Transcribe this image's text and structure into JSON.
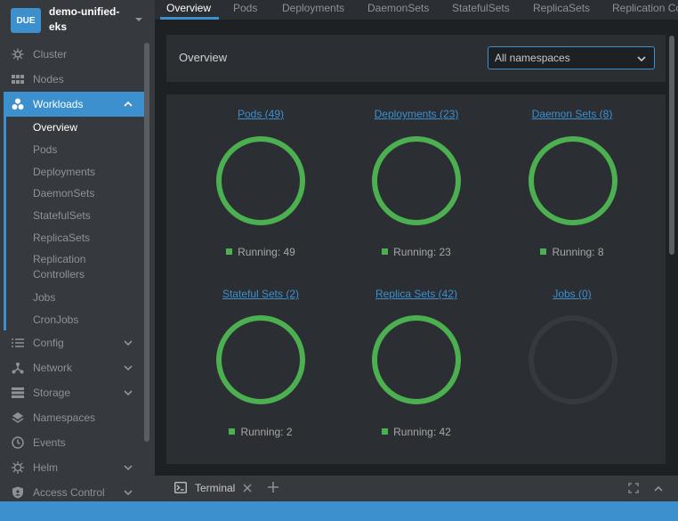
{
  "cluster": {
    "badge": "DUE",
    "name": "demo-unified-eks"
  },
  "sidebar": {
    "items": [
      {
        "label": "Cluster",
        "icon": "cluster-icon"
      },
      {
        "label": "Nodes",
        "icon": "nodes-icon"
      },
      {
        "label": "Workloads",
        "icon": "workloads-icon",
        "expanded": true
      },
      {
        "label": "Config",
        "icon": "config-icon"
      },
      {
        "label": "Network",
        "icon": "network-icon"
      },
      {
        "label": "Storage",
        "icon": "storage-icon"
      },
      {
        "label": "Namespaces",
        "icon": "namespaces-icon"
      },
      {
        "label": "Events",
        "icon": "events-icon"
      },
      {
        "label": "Helm",
        "icon": "helm-icon"
      },
      {
        "label": "Access Control",
        "icon": "access-control-icon"
      }
    ],
    "workloads_sub": [
      "Overview",
      "Pods",
      "Deployments",
      "DaemonSets",
      "StatefulSets",
      "ReplicaSets",
      "Replication Controllers",
      "Jobs",
      "CronJobs"
    ]
  },
  "tabs": [
    "Overview",
    "Pods",
    "Deployments",
    "DaemonSets",
    "StatefulSets",
    "ReplicaSets",
    "Replication Controllers"
  ],
  "overview": {
    "title": "Overview",
    "namespace_select": "All namespaces"
  },
  "charts": [
    {
      "title": "Pods (49)",
      "legend": "Running: 49",
      "running": 49,
      "total": 49
    },
    {
      "title": "Deployments (23)",
      "legend": "Running: 23",
      "running": 23,
      "total": 23
    },
    {
      "title": "Daemon Sets (8)",
      "legend": "Running: 8",
      "running": 8,
      "total": 8
    },
    {
      "title": "Stateful Sets (2)",
      "legend": "Running: 2",
      "running": 2,
      "total": 2
    },
    {
      "title": "Replica Sets (42)",
      "legend": "Running: 42",
      "running": 42,
      "total": 42
    },
    {
      "title": "Jobs (0)",
      "legend": "",
      "running": 0,
      "total": 0
    }
  ],
  "terminal": {
    "label": "Terminal"
  },
  "colors": {
    "accent": "#3d90ce",
    "running": "#4caf50",
    "empty_ring": "#36393e"
  }
}
